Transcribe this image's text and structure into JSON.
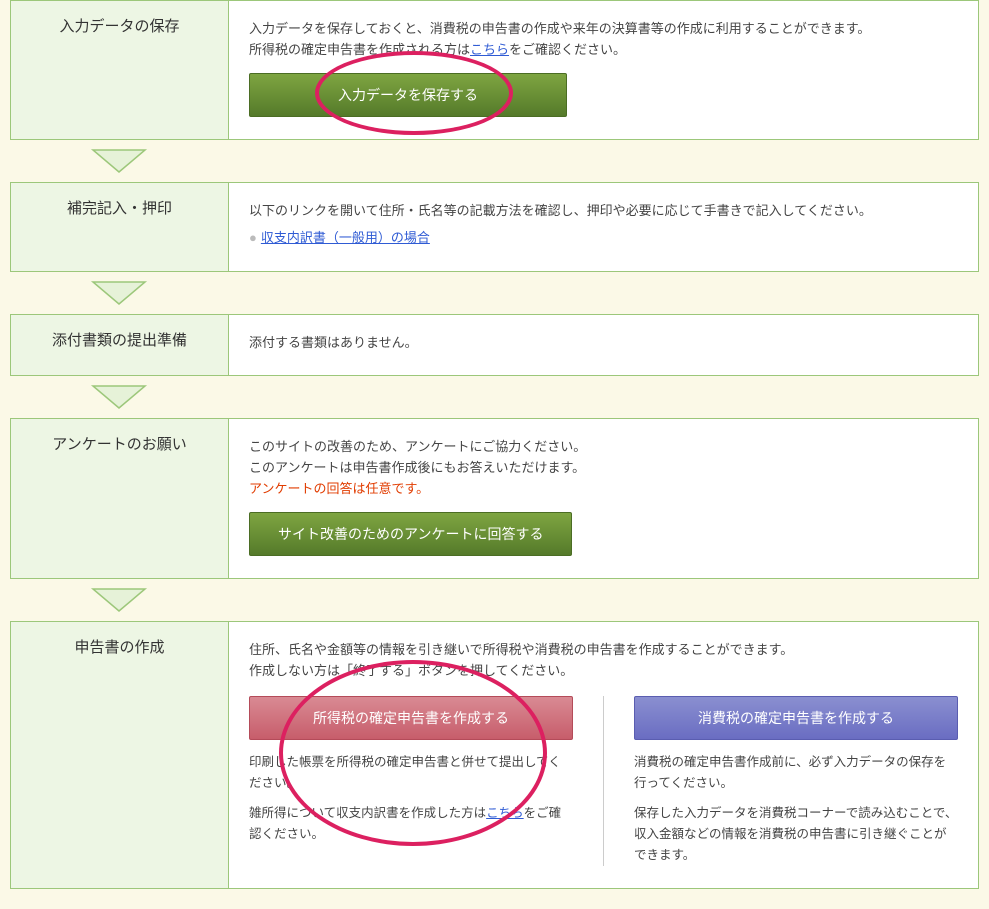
{
  "sections": {
    "save": {
      "title": "入力データの保存",
      "line1": "入力データを保存しておくと、消費税の申告書の作成や来年の決算書等の作成に利用することができます。",
      "line2a": "所得税の確定申告書を作成される方は",
      "line2_link": "こちら",
      "line2b": "をご確認ください。",
      "button": "入力データを保存する"
    },
    "fill": {
      "title": "補完記入・押印",
      "line1": "以下のリンクを開いて住所・氏名等の記載方法を確認し、押印や必要に応じて手書きで記入してください。",
      "link": "収支内訳書（一般用）の場合"
    },
    "attach": {
      "title": "添付書類の提出準備",
      "line1": "添付する書類はありません。"
    },
    "survey": {
      "title": "アンケートのお願い",
      "line1": "このサイトの改善のため、アンケートにご協力ください。",
      "line2": "このアンケートは申告書作成後にもお答えいただけます。",
      "line3": "アンケートの回答は任意です。",
      "button": "サイト改善のためのアンケートに回答する"
    },
    "create": {
      "title": "申告書の作成",
      "line1": "住所、氏名や金額等の情報を引き継いで所得税や消費税の申告書を作成することができます。",
      "line2": "作成しない方は「終了する」ボタンを押してください。",
      "col1_button": "所得税の確定申告書を作成する",
      "col1_note1": "印刷した帳票を所得税の確定申告書と併せて提出してください。",
      "col1_note2a": "雑所得について収支内訳書を作成した方は",
      "col1_note2_link": "こちら",
      "col1_note2b": "をご確認ください。",
      "col2_button": "消費税の確定申告書を作成する",
      "col2_note1": "消費税の確定申告書作成前に、必ず入力データの保存を行ってください。",
      "col2_note2": "保存した入力データを消費税コーナーで読み込むことで、収入金額などの情報を消費税の申告書に引き継ぐことができます。"
    }
  }
}
